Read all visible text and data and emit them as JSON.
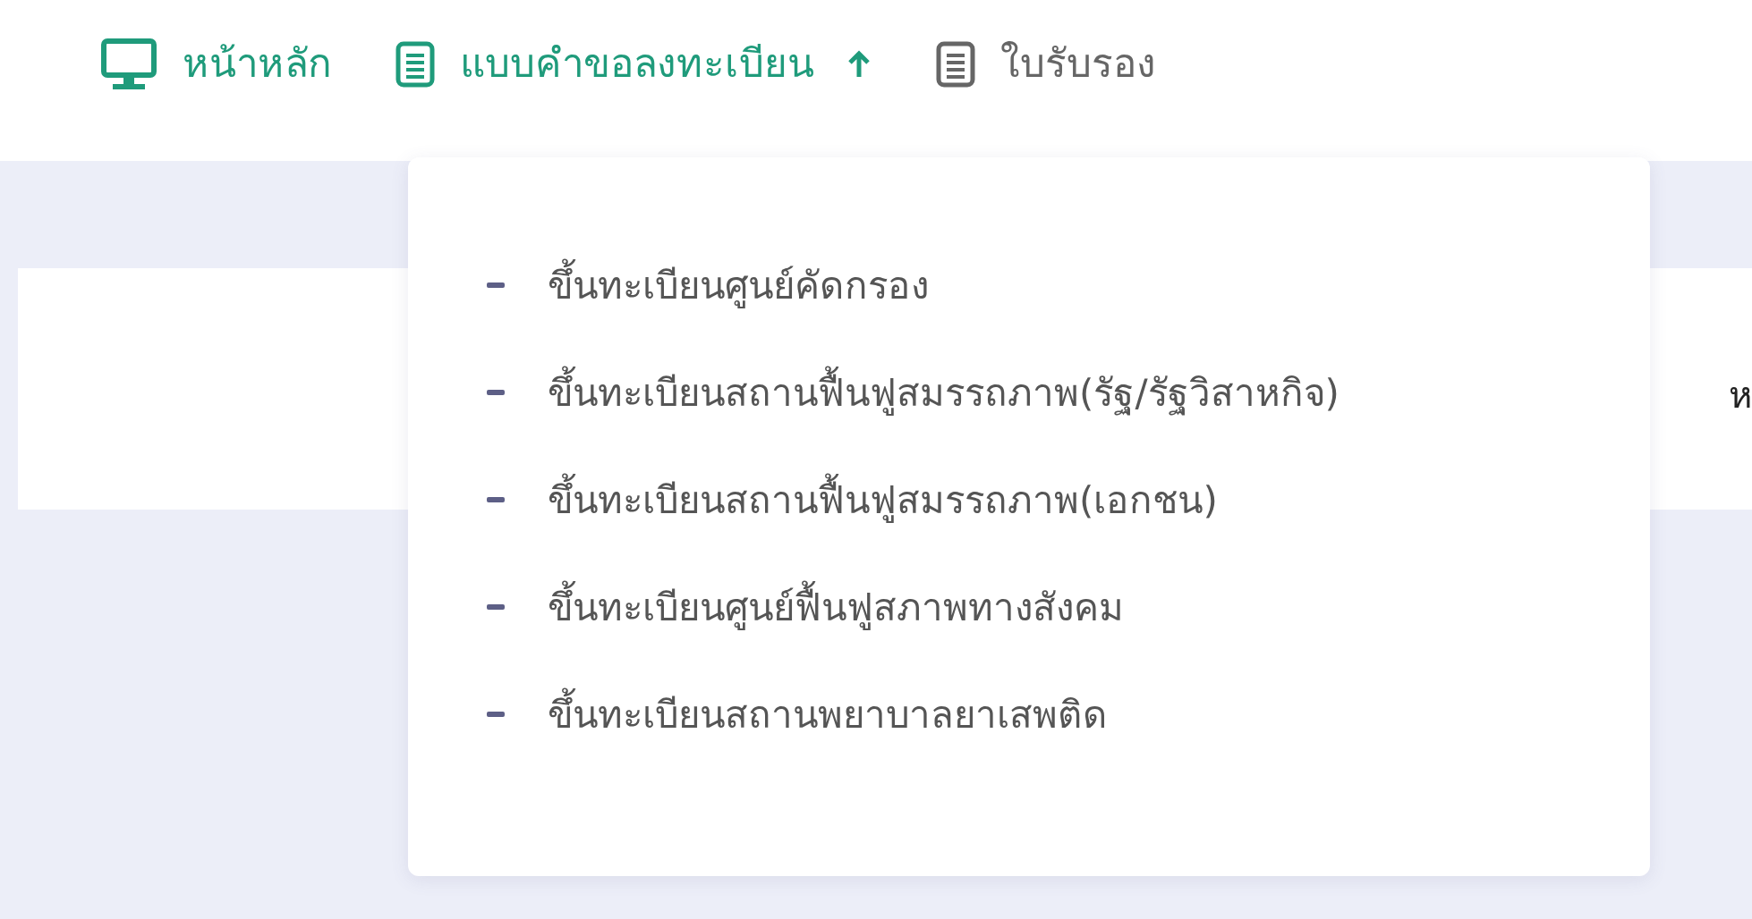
{
  "nav": [
    {
      "label": "หน้าหลัก",
      "kind": "monitor",
      "color": "#1f9b7b",
      "expanded": false
    },
    {
      "label": "แบบคำขอลงทะเบียน",
      "kind": "document",
      "color": "#1f9b7b",
      "expanded": true
    },
    {
      "label": "ใบรับรอง",
      "kind": "document",
      "color": "#666666",
      "expanded": false
    }
  ],
  "dropdown": {
    "items": [
      "ขึ้นทะเบียนศูนย์คัดกรอง",
      "ขึ้นทะเบียนสถานฟื้นฟูสมรรถภาพ(รัฐ/รัฐวิสาหกิจ)",
      "ขึ้นทะเบียนสถานฟื้นฟูสมรรถภาพ(เอกชน)",
      "ขึ้นทะเบียนศูนย์ฟื้นฟูสภาพทางสังคม",
      "ขึ้นทะเบียนสถานพยาบาลยาเสพติด"
    ]
  },
  "panel": {
    "text": "ห"
  }
}
